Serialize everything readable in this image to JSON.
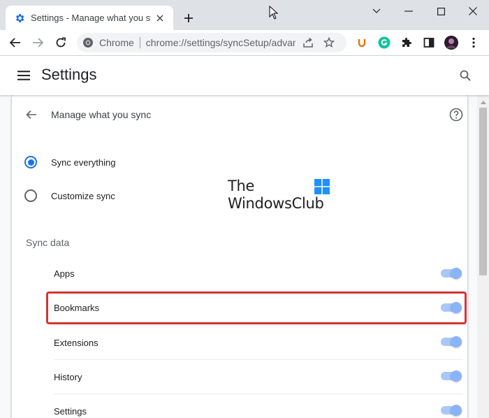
{
  "browser": {
    "tab_title": "Settings - Manage what you sync",
    "omnibox_chip": "Chrome",
    "url": "chrome://settings/syncSetup/advanced"
  },
  "settings": {
    "header_title": "Settings",
    "page_title": "Manage what you sync",
    "sync_options": [
      {
        "label": "Sync everything",
        "checked": true
      },
      {
        "label": "Customize sync",
        "checked": false
      }
    ],
    "section_title": "Sync data",
    "items": [
      {
        "label": "Apps",
        "enabled": true
      },
      {
        "label": "Bookmarks",
        "enabled": true
      },
      {
        "label": "Extensions",
        "enabled": true
      },
      {
        "label": "History",
        "enabled": true
      },
      {
        "label": "Settings",
        "enabled": true
      }
    ]
  },
  "watermark": {
    "line1": "The",
    "line2": "WindowsClub"
  },
  "colors": {
    "accent": "#1a73e8",
    "toggle_track": "#a8c7fa",
    "toggle_knob": "#8ab4f8",
    "highlight": "#d13438",
    "tabstrip": "#dee1e6"
  },
  "icons": {
    "tab_favicon": "gear-icon",
    "new_tab": "plus-icon",
    "back": "arrow-left-icon",
    "forward": "arrow-right-icon",
    "reload": "reload-icon",
    "share": "share-icon",
    "bookmark": "star-icon",
    "extensions": "puzzle-icon",
    "side_panel": "side-panel-icon",
    "menu": "kebab-menu-icon",
    "search": "search-icon",
    "help": "help-icon"
  }
}
